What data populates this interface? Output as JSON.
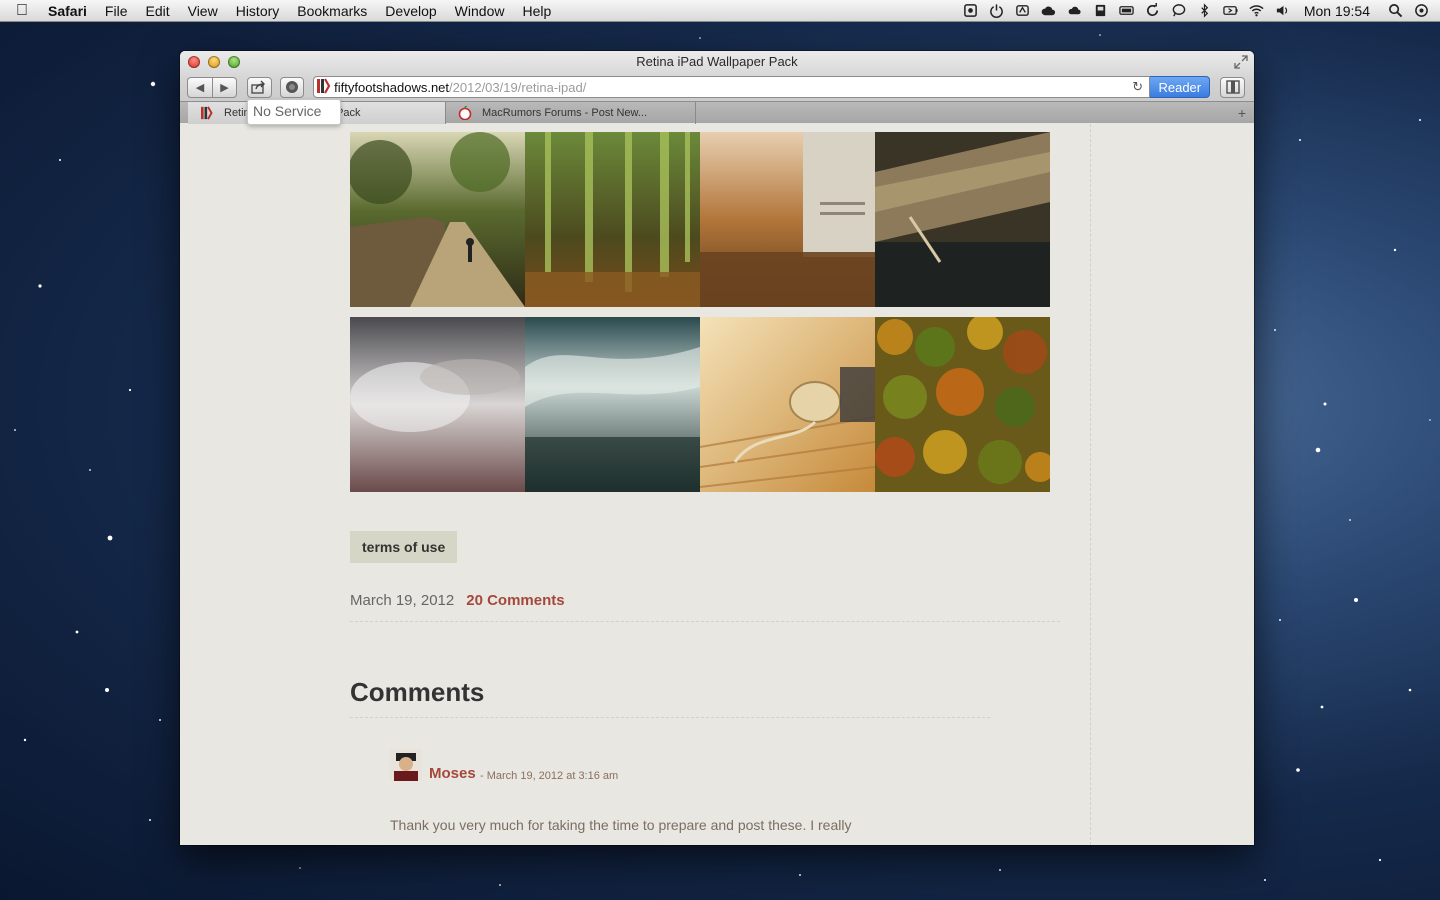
{
  "menubar": {
    "apple_icon": "apple-logo-icon",
    "app_name": "Safari",
    "menus": [
      "File",
      "Edit",
      "View",
      "History",
      "Bookmarks",
      "Develop",
      "Window",
      "Help"
    ],
    "status_icons": [
      "screenshot-icon",
      "power-icon",
      "wacom-icon",
      "cloud-app-icon",
      "icloud-icon",
      "printer-icon",
      "battery-meter-icon",
      "sync-icon",
      "messages-icon",
      "bluetooth-icon",
      "battery-icon",
      "wifi-icon",
      "volume-icon"
    ],
    "clock": "Mon 19:54"
  },
  "window": {
    "title": "Retina iPad Wallpaper Pack",
    "url_domain": "fiftyfootshadows.net",
    "url_path": "/2012/03/19/retina-ipad/",
    "reader_label": "Reader",
    "tabs": [
      {
        "title": "Retina iPad Wallpaper Pack",
        "active": true
      },
      {
        "title": "MacRumors Forums - Post New...",
        "active": false
      }
    ],
    "popover_text": "No Service"
  },
  "page": {
    "terms_label": "terms of use",
    "post_date": "March 19, 2012",
    "comments_link": "20 Comments",
    "comments_heading": "Comments",
    "comment": {
      "author": "Moses",
      "date": "- March 19, 2012 at 3:16 am",
      "text": "Thank you very much for taking the time to prepare and post these. I really"
    }
  },
  "colors": {
    "accent_link": "#a5483c",
    "reader_blue": "#3a7de0",
    "page_background": "#e9e7e2"
  }
}
